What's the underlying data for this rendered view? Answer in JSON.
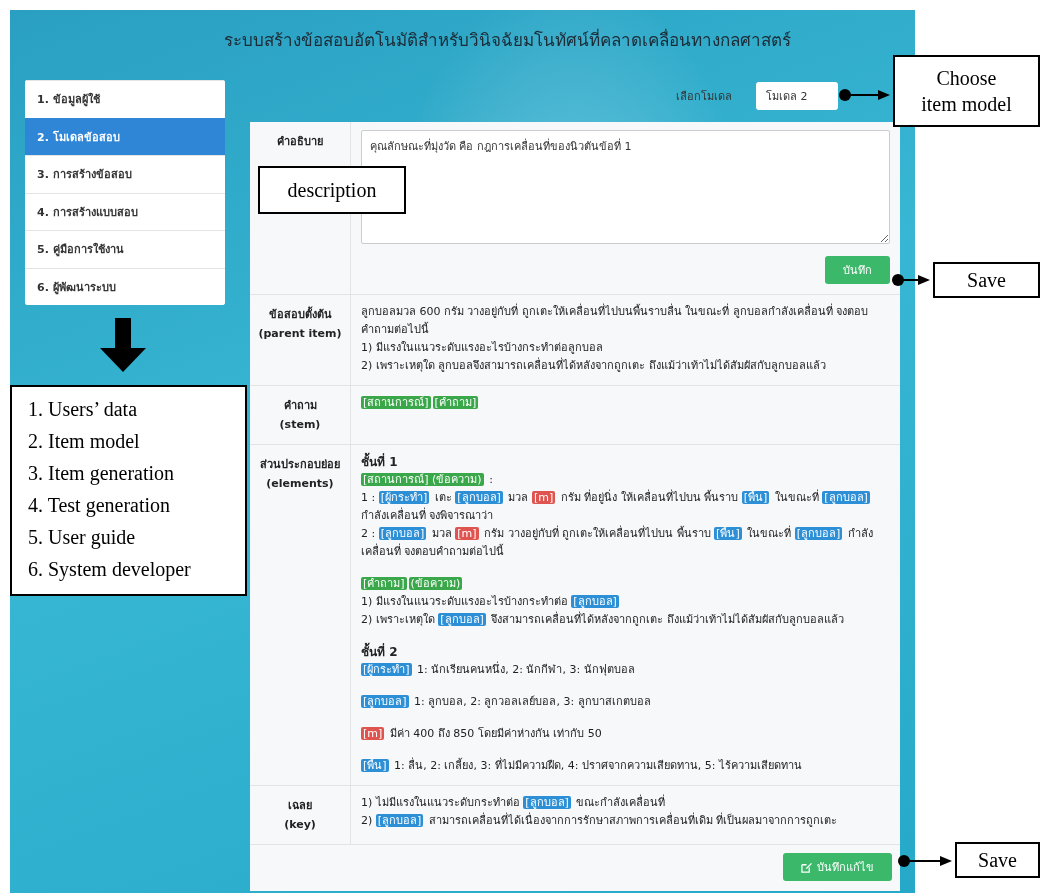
{
  "title": "ระบบสร้างข้อสอบอัตโนมัติสำหรับวินิจฉัยมโนทัศน์ที่คลาดเคลื่อนทางกลศาสตร์",
  "sidebar": {
    "items": [
      {
        "label": "1. ข้อมูลผู้ใช้",
        "selected": false
      },
      {
        "label": "2. โมเดลข้อสอบ",
        "selected": true
      },
      {
        "label": "3. การสร้างข้อสอบ",
        "selected": false
      },
      {
        "label": "4. การสร้างแบบสอบ",
        "selected": false
      },
      {
        "label": "5. คู่มือการใช้งาน",
        "selected": false
      },
      {
        "label": "6. ผู้พัฒนาระบบ",
        "selected": false
      }
    ]
  },
  "model_select": {
    "label": "เลือกโมเดล",
    "value": "โมเดล 2"
  },
  "rows": [
    {
      "kind": "description",
      "label": "คำอธิบาย",
      "value": "คุณลักษณะที่มุ่งวัด คือ กฎการเคลื่อนที่ของนิวตันข้อที่ 1",
      "button": "บันทึก"
    },
    {
      "kind": "rich",
      "label": "ข้อสอบตั้งต้น",
      "sublabel": "(parent item)",
      "blocks": [
        [
          {
            "kind": "text",
            "text": "ลูกบอลมวล 600 กรัม วางอยู่กับที่ ถูกเตะให้เคลื่อนที่ไปบนพื้นราบลื่น ในขณะที่ ลูกบอลกำลังเคลื่อนที่ จงตอบคำถามต่อไปนี้"
          },
          {
            "kind": "text",
            "text": "1) มีแรงในแนวระดับแรงอะไรบ้างกระทำต่อลูกบอล"
          },
          {
            "kind": "text",
            "text": "2) เพราะเหตุใด ลูกบอลจึงสามารถเคลื่อนที่ได้หลังจากถูกเตะ ถึงแม้ว่าเท้าไม่ได้สัมผัสกับลูกบอลแล้ว"
          }
        ]
      ]
    },
    {
      "kind": "rich",
      "label": "คำถาม",
      "sublabel": "(stem)",
      "blocks": [
        [
          {
            "kind": "line",
            "segments": [
              {
                "kind": "tag",
                "text": "[สถานการณ์]",
                "color": "#3aa84a"
              },
              {
                "kind": "tag",
                "text": "[คำถาม]",
                "color": "#3aa84a"
              }
            ]
          }
        ]
      ]
    },
    {
      "kind": "rich",
      "label": "ส่วนประกอบย่อย",
      "sublabel": "(elements)",
      "blocks": [
        [
          {
            "kind": "heading",
            "text": "ชั้นที่ 1"
          },
          {
            "kind": "line",
            "segments": [
              {
                "kind": "tag",
                "text": "[สถานการณ์] (ข้อความ)",
                "color": "#3aa84a"
              },
              {
                "kind": "text",
                "text": " :"
              }
            ]
          },
          {
            "kind": "line",
            "segments": [
              {
                "kind": "text",
                "text": "1 : "
              },
              {
                "kind": "tag",
                "text": "[ผู้กระทำ]",
                "color": "#2d8fd6"
              },
              {
                "kind": "text",
                "text": " เตะ "
              },
              {
                "kind": "tag",
                "text": "[ลูกบอล]",
                "color": "#2d8fd6"
              },
              {
                "kind": "text",
                "text": " มวล "
              },
              {
                "kind": "tag",
                "text": "[m]",
                "color": "#e05450"
              },
              {
                "kind": "text",
                "text": " กรัม ที่อยู่นิ่ง ให้เคลื่อนที่ไปบน พื้นราบ "
              },
              {
                "kind": "tag",
                "text": "[พื้น]",
                "color": "#2d8fd6"
              },
              {
                "kind": "text",
                "text": " ในขณะที่ "
              },
              {
                "kind": "tag",
                "text": "[ลูกบอล]",
                "color": "#2d8fd6"
              },
              {
                "kind": "text",
                "text": " กำลังเคลื่อนที่ จงพิจารณาว่า"
              }
            ]
          },
          {
            "kind": "line",
            "segments": [
              {
                "kind": "text",
                "text": "2 : "
              },
              {
                "kind": "tag",
                "text": "[ลูกบอล]",
                "color": "#2d8fd6"
              },
              {
                "kind": "text",
                "text": " มวล "
              },
              {
                "kind": "tag",
                "text": "[m]",
                "color": "#e05450"
              },
              {
                "kind": "text",
                "text": " กรัม วางอยู่กับที่ ถูกเตะให้เคลื่อนที่ไปบน พื้นราบ "
              },
              {
                "kind": "tag",
                "text": "[พื้น]",
                "color": "#2d8fd6"
              },
              {
                "kind": "text",
                "text": " ในขณะที่ "
              },
              {
                "kind": "tag",
                "text": "[ลูกบอล]",
                "color": "#2d8fd6"
              },
              {
                "kind": "text",
                "text": " กำลังเคลื่อนที่ จงตอบคำถามต่อไปนี้"
              }
            ]
          }
        ],
        [
          {
            "kind": "line",
            "segments": [
              {
                "kind": "tag",
                "text": "[คำถาม]",
                "color": "#3aa84a"
              },
              {
                "kind": "tag",
                "text": "(ข้อความ)",
                "color": "#3aa84a"
              }
            ]
          },
          {
            "kind": "line",
            "segments": [
              {
                "kind": "text",
                "text": "1) มีแรงในแนวระดับแรงอะไรบ้างกระทำต่อ "
              },
              {
                "kind": "tag",
                "text": "[ลูกบอล]",
                "color": "#2d8fd6"
              }
            ]
          },
          {
            "kind": "line",
            "segments": [
              {
                "kind": "text",
                "text": "2) เพราะเหตุใด "
              },
              {
                "kind": "tag",
                "text": "[ลูกบอล]",
                "color": "#2d8fd6"
              },
              {
                "kind": "text",
                "text": " จึงสามารถเคลื่อนที่ได้หลังจากถูกเตะ ถึงแม้ว่าเท้าไม่ได้สัมผัสกับลูกบอลแล้ว"
              }
            ]
          }
        ],
        [
          {
            "kind": "heading",
            "text": "ชั้นที่ 2"
          },
          {
            "kind": "line",
            "segments": [
              {
                "kind": "tag",
                "text": "[ผู้กระทำ]",
                "color": "#2d8fd6"
              },
              {
                "kind": "text",
                "text": "  1: นักเรียนคนหนึ่ง, 2: นักกีฬา, 3: นักฟุตบอล"
              }
            ]
          }
        ],
        [
          {
            "kind": "line",
            "segments": [
              {
                "kind": "tag",
                "text": "[ลูกบอล]",
                "color": "#2d8fd6"
              },
              {
                "kind": "text",
                "text": "  1: ลูกบอล, 2: ลูกวอลเลย์บอล, 3: ลูกบาสเกตบอล"
              }
            ]
          }
        ],
        [
          {
            "kind": "line",
            "segments": [
              {
                "kind": "tag",
                "text": "[m]",
                "color": "#e05450"
              },
              {
                "kind": "text",
                "text": "  มีค่า 400 ถึง 850 โดยมีค่าห่างกัน เท่ากับ 50"
              }
            ]
          }
        ],
        [
          {
            "kind": "line",
            "segments": [
              {
                "kind": "tag",
                "text": "[พื้น]",
                "color": "#2d8fd6"
              },
              {
                "kind": "text",
                "text": "  1: ลื่น, 2: เกลี้ยง, 3: ที่ไม่มีความฝืด, 4: ปราศจากความเสียดทาน, 5: ไร้ความเสียดทาน"
              }
            ]
          }
        ]
      ]
    },
    {
      "kind": "rich",
      "label": "เฉลย",
      "sublabel": "(key)",
      "blocks": [
        [
          {
            "kind": "line",
            "segments": [
              {
                "kind": "text",
                "text": "1) ไม่มีแรงในแนวระดับกระทำต่อ "
              },
              {
                "kind": "tag",
                "text": "[ลูกบอล]",
                "color": "#2d8fd6"
              },
              {
                "kind": "text",
                "text": " ขณะกำลังเคลื่อนที่"
              }
            ]
          },
          {
            "kind": "line",
            "segments": [
              {
                "kind": "text",
                "text": "2) "
              },
              {
                "kind": "tag",
                "text": "[ลูกบอล]",
                "color": "#2d8fd6"
              },
              {
                "kind": "text",
                "text": " สามารถเคลื่อนที่ได้เนื่องจากการรักษาสภาพการเคลื่อนที่เดิม ที่เป็นผลมาจากการถูกเตะ"
              }
            ]
          }
        ]
      ]
    }
  ],
  "save_edit_button": "บันทึกแก้ไข",
  "annotations": {
    "callouts": [
      {
        "lines": [
          "Choose",
          "item model"
        ]
      },
      {
        "lines": [
          "description"
        ]
      },
      {
        "lines": [
          "Save"
        ]
      },
      {
        "lines": [
          "Save"
        ]
      }
    ],
    "legend": [
      "1. Users’ data",
      "2. Item model",
      "3. Item generation",
      "4. Test generation",
      "5. User guide",
      "6. System developer"
    ]
  }
}
